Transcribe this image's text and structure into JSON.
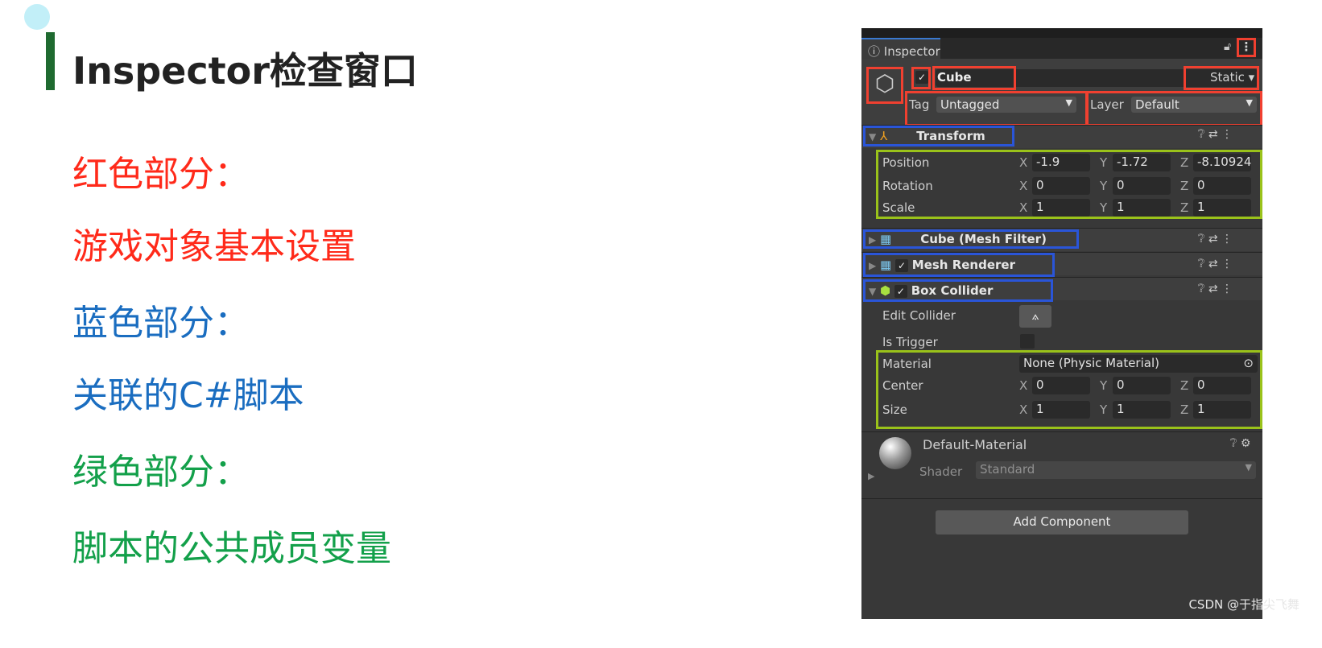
{
  "slide": {
    "title": "Inspector检查窗口",
    "lines": [
      {
        "text": "红色部分：",
        "color": "#ff2a1a"
      },
      {
        "text": "游戏对象基本设置",
        "color": "#ff2a1a"
      },
      {
        "text": "蓝色部分：",
        "color": "#1a6dc0"
      },
      {
        "text": "关联的C#脚本",
        "color": "#1a6dc0"
      },
      {
        "text": "绿色部分：",
        "color": "#13a04a"
      },
      {
        "text": "脚本的公共成员变量",
        "color": "#13a04a"
      }
    ]
  },
  "inspector": {
    "tab_label": "Inspector",
    "object_name": "Cube",
    "active": true,
    "static_label": "Static",
    "tag_label": "Tag",
    "tag_value": "Untagged",
    "layer_label": "Layer",
    "layer_value": "Default",
    "transform": {
      "title": "Transform",
      "rows": [
        {
          "label": "Position",
          "x": "-1.9",
          "y": "-1.72",
          "z": "-8.10924"
        },
        {
          "label": "Rotation",
          "x": "0",
          "y": "0",
          "z": "0"
        },
        {
          "label": "Scale",
          "x": "1",
          "y": "1",
          "z": "1"
        }
      ]
    },
    "mesh_filter": {
      "title": "Cube (Mesh Filter)"
    },
    "mesh_renderer": {
      "title": "Mesh Renderer",
      "enabled": true
    },
    "box_collider": {
      "title": "Box Collider",
      "enabled": true,
      "edit_collider_label": "Edit Collider",
      "is_trigger_label": "Is Trigger",
      "material_label": "Material",
      "material_value": "None (Physic Material)",
      "rows": [
        {
          "label": "Center",
          "x": "0",
          "y": "0",
          "z": "0"
        },
        {
          "label": "Size",
          "x": "1",
          "y": "1",
          "z": "1"
        }
      ]
    },
    "material": {
      "name": "Default-Material",
      "shader_label": "Shader",
      "shader_value": "Standard"
    },
    "add_component_label": "Add Component",
    "axis": {
      "x": "X",
      "y": "Y",
      "z": "Z"
    }
  },
  "watermark": "CSDN @于指尖飞舞",
  "colors": {
    "red_box": "#f04030",
    "blue_box": "#2a55d8",
    "green_box": "#9ac21a",
    "accent_bar": "#1f6a30"
  }
}
